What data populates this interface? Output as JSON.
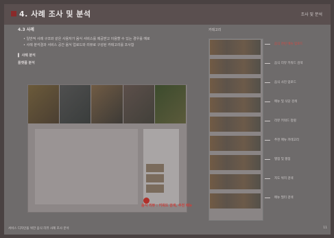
{
  "header": {
    "title": "4. 사례 조사 및 분석",
    "top_right": "조사 및 분석"
  },
  "left": {
    "section": "4.3 사례",
    "bullets": [
      "일반적 사례 구조와 같은 사용자가 음식 서비스를 제공받고 이용할 수 있는 경우를 예로",
      "사례 분석결과 서비스 공간 음식 업로드와 리뷰로 구성된 카테고리를 조사함"
    ],
    "subhead": "▌ 사례 분석",
    "subhead2": "플랫폼 분석",
    "caption": "음식 리뷰 : 키워드 검색, 추천 메뉴"
  },
  "right": {
    "title": "카테고리",
    "labels": [
      "음식 관련 메뉴 업로드",
      "음식 리뷰 키워드 검색",
      "음식 사진 업로드",
      "메뉴 및 식당 검색",
      "리뷰 키워드 정렬",
      "추천 메뉴 카테고리",
      "별점 및 평점",
      "지도 위치 검색",
      "메뉴 필터 검색"
    ]
  },
  "footer": {
    "left": "서비스 디자인을 위한 음식 리뷰 사례 조사 분석",
    "right": "11"
  },
  "colors": {
    "accent": "#d14a44",
    "topbar": "#5a4f4f"
  }
}
